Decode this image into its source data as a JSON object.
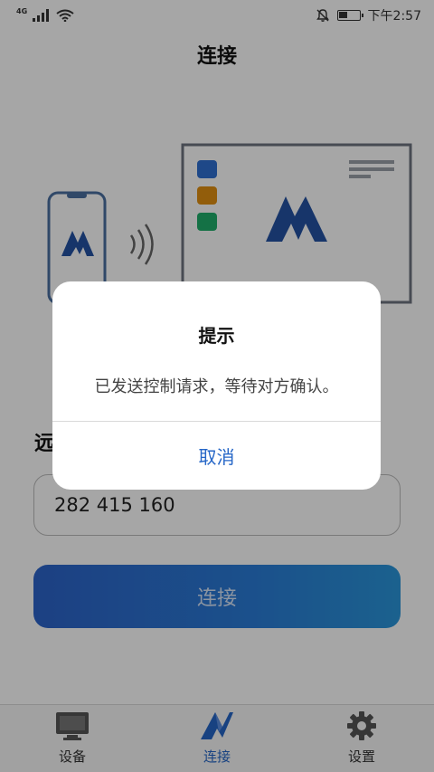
{
  "status_bar": {
    "network_type": "4G",
    "time": "下午2:57"
  },
  "header": {
    "title": "连接"
  },
  "main": {
    "remote_label": "远",
    "device_id_value": "282 415 160",
    "connect_button_label": "连接"
  },
  "dialog": {
    "title": "提示",
    "message": "已发送控制请求，等待对方确认。",
    "cancel_label": "取消"
  },
  "tab_bar": {
    "tabs": [
      {
        "label": "设备",
        "icon": "monitor-icon"
      },
      {
        "label": "连接",
        "icon": "logo-icon",
        "active": true
      },
      {
        "label": "设置",
        "icon": "gear-icon"
      }
    ]
  },
  "colors": {
    "accent": "#2566c7",
    "button_gradient_start": "#2b63c9",
    "button_gradient_end": "#2a96da",
    "overlay": "rgba(0,0,0,0.35)"
  }
}
